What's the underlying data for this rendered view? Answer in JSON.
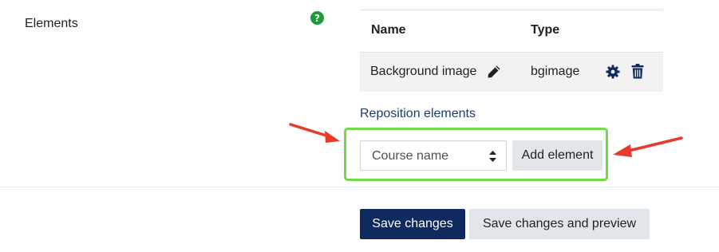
{
  "form": {
    "elements_label": "Elements",
    "help_icon": "question-circle-icon"
  },
  "table": {
    "headers": [
      "Name",
      "Type"
    ],
    "rows": [
      {
        "name": "Background image",
        "type": "bgimage",
        "icons": [
          "pencil-icon",
          "gear-icon",
          "trash-icon"
        ]
      }
    ]
  },
  "reposition_link": "Reposition elements",
  "element_select": {
    "value": "Course name"
  },
  "add_element_button": "Add element",
  "actions": {
    "save": "Save changes",
    "save_preview": "Save changes and preview"
  },
  "colors": {
    "highlight_border": "#6fdc45",
    "annotation_arrow": "#e8392b",
    "primary_button": "#0f2a5e",
    "help_icon": "#1c9a3c"
  }
}
